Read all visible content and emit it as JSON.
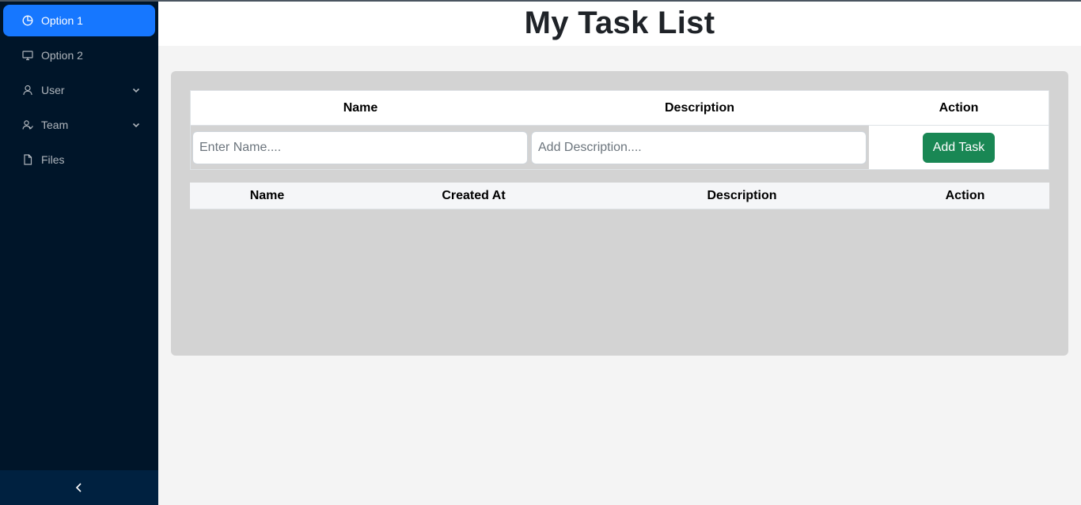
{
  "sidebar": {
    "items": [
      {
        "label": "Option 1",
        "icon": "pie-chart-icon",
        "active": true
      },
      {
        "label": "Option 2",
        "icon": "desktop-icon",
        "active": false
      },
      {
        "label": "User",
        "icon": "user-icon",
        "active": false,
        "expandable": true
      },
      {
        "label": "Team",
        "icon": "team-icon",
        "active": false,
        "expandable": true
      },
      {
        "label": "Files",
        "icon": "file-icon",
        "active": false
      }
    ],
    "collapse_icon": "chevron-left-icon"
  },
  "header": {
    "title": "My Task List"
  },
  "form": {
    "headers": [
      "Name",
      "Description",
      "Action"
    ],
    "name_placeholder": "Enter Name....",
    "description_placeholder": "Add Description....",
    "add_button": "Add Task"
  },
  "list": {
    "headers": [
      "Name",
      "Created At",
      "Description",
      "Action"
    ],
    "rows": []
  },
  "colors": {
    "sidebar_bg": "#001529",
    "active_item": "#1677ff",
    "add_button": "#198754",
    "panel_bg": "#d3d3d3"
  }
}
